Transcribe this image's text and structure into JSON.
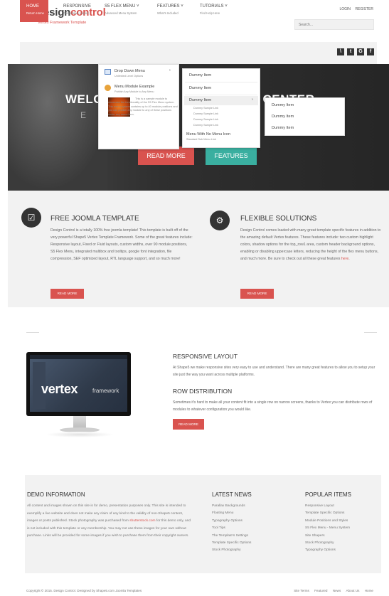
{
  "header": {
    "logo_brand_a": "design",
    "logo_brand_b": "control",
    "logo_tagline": "Vertex Framework Template",
    "top_links": [
      "LOGIN",
      "REGISTER"
    ],
    "search_placeholder": "Search..."
  },
  "colors": {
    "accent": "#d9534f",
    "teal": "#3aafa0",
    "dark": "#333333"
  },
  "nav": [
    {
      "label": "HOME",
      "sub": "Return Home"
    },
    {
      "label": "RESPONSIVE",
      "sub": "Responsive Layout"
    },
    {
      "label": "S5 FLEX MENU ˅",
      "sub": "Advanced Menu System"
    },
    {
      "label": "FEATURES ˅",
      "sub": "What's Included"
    },
    {
      "label": "TUTORIALS ˅",
      "sub": "Find Help Here"
    }
  ],
  "social": [
    "rss-icon",
    "twitter-icon",
    "google-icon",
    "facebook-icon"
  ],
  "social_glyphs": [
    "\\",
    "t",
    "G",
    "f"
  ],
  "hero": {
    "title_left": "WELC",
    "title_right": "OL CENTER",
    "sub_left": "E",
    "read_more": "READ MORE",
    "features": "FEATURES"
  },
  "flexmenu": {
    "col1": [
      {
        "title": "Drop Down Menu",
        "sub": "Unlimited Level Options",
        "arrow": "›"
      },
      {
        "title": "Menu Module Example",
        "sub": "Publish Any Module to Any Menu"
      }
    ],
    "module_text": "This is a sample module to showcase the functionality of the S5 Flex Menu system. This menu system contains up to 40 module positions and you can publish any module to any of these positions under any menu item.",
    "col2": [
      "Dummy Item",
      "Dummy Item",
      "Dummy Item"
    ],
    "col2_arrow": "›",
    "col2_small": [
      "Dummy Sample Link",
      "Dummy Sample Link",
      "Dummy Sample Link",
      "Dummy Sample Link"
    ],
    "col2_last": {
      "title": "Menu With No Menu Icon",
      "sub": "Standard Sub Menu Link"
    },
    "col3": [
      "Dummy Item",
      "Dummy Item",
      "Dummy Item"
    ]
  },
  "features": [
    {
      "title": "FREE JOOMLA TEMPLATE",
      "icon": "checkbox-icon",
      "glyph": "☑",
      "body": "Design Control is a totally 100% free joomla template! This template is built off of the very powerful Shape5 Vertex Template Framework. Some of the great features include: Responsive layout, Fixed or Fluid layouts, custom widths, over 90 module positions, S5 Flex Menu, integrated multibox and tooltips, google font integration, file compression, SEF optimized layout, RTL language support, and so much more!",
      "button": "READ MORE"
    },
    {
      "title": "FLEXIBLE SOLUTIONS",
      "icon": "gears-icon",
      "glyph": "⚙",
      "body": "Design Control comes loaded with many great template specific features in addition to the amazing default Vertex features. These features include: two custom highlight colors, shadow options for the top_row1 area, custom header background options, enabling or disabling uppercase letters, reducing the height of the flex menu buttons, and much more. Be sure to check out all these great features ",
      "link": "here",
      "tail": ".",
      "button": "READ MORE"
    }
  ],
  "showcase": {
    "vertex_word": "vertex",
    "vertex_fw": "framework",
    "h1": "RESPONSIVE LAYOUT",
    "p1": "At Shape5 we make responsive sites very easy to use and understand. There are many great features to allow you to setup your site just the way you want across multiple platforms.",
    "h2": "ROW DISTRIBUTION",
    "p2": "Sometimes it's hard to make all your content fit into a single row on narrow screens, thanks to Vertex you can distribute rows of modules to whatever configuration you would like.",
    "button": "READ MORE"
  },
  "footer": {
    "demo_title": "DEMO INFORMATION",
    "demo_a": "All content and images shown on this site is for demo, presentation purposes only. This site is intended to exemplify a live website and does not make any claim of any kind to the validity of non-Shape5 content, images or posts published. Stock photography was purchased from ",
    "demo_link": "shutterstock.com",
    "demo_b": " for this demo only, and is not included with this template or any membership. You may not use these images for your own without purchase. Links will be provided for some images if you wish to purchase them from their copyright owners.",
    "news_title": "LATEST NEWS",
    "news": [
      "Parallax Backgrounds",
      "Floating Menu",
      "Typography Options",
      "Tool Tips",
      "The Template's Settings",
      "Template Specific Options",
      "Stock Photography"
    ],
    "popular_title": "POPULAR ITEMS",
    "popular": [
      "Responsive Layout",
      "Template Specific Options",
      "Module Positions and Styles",
      "S5 Flex Menu - Menu System",
      "Site Shapers",
      "Stock Photography",
      "Typography Options"
    ]
  },
  "bottom": {
    "copyright": "Copyright © 2015. Design Control. Designed by Shape5.com Joomla Templates",
    "links": [
      "Site Terms",
      "Featured",
      "News",
      "About Us",
      "Home"
    ]
  }
}
